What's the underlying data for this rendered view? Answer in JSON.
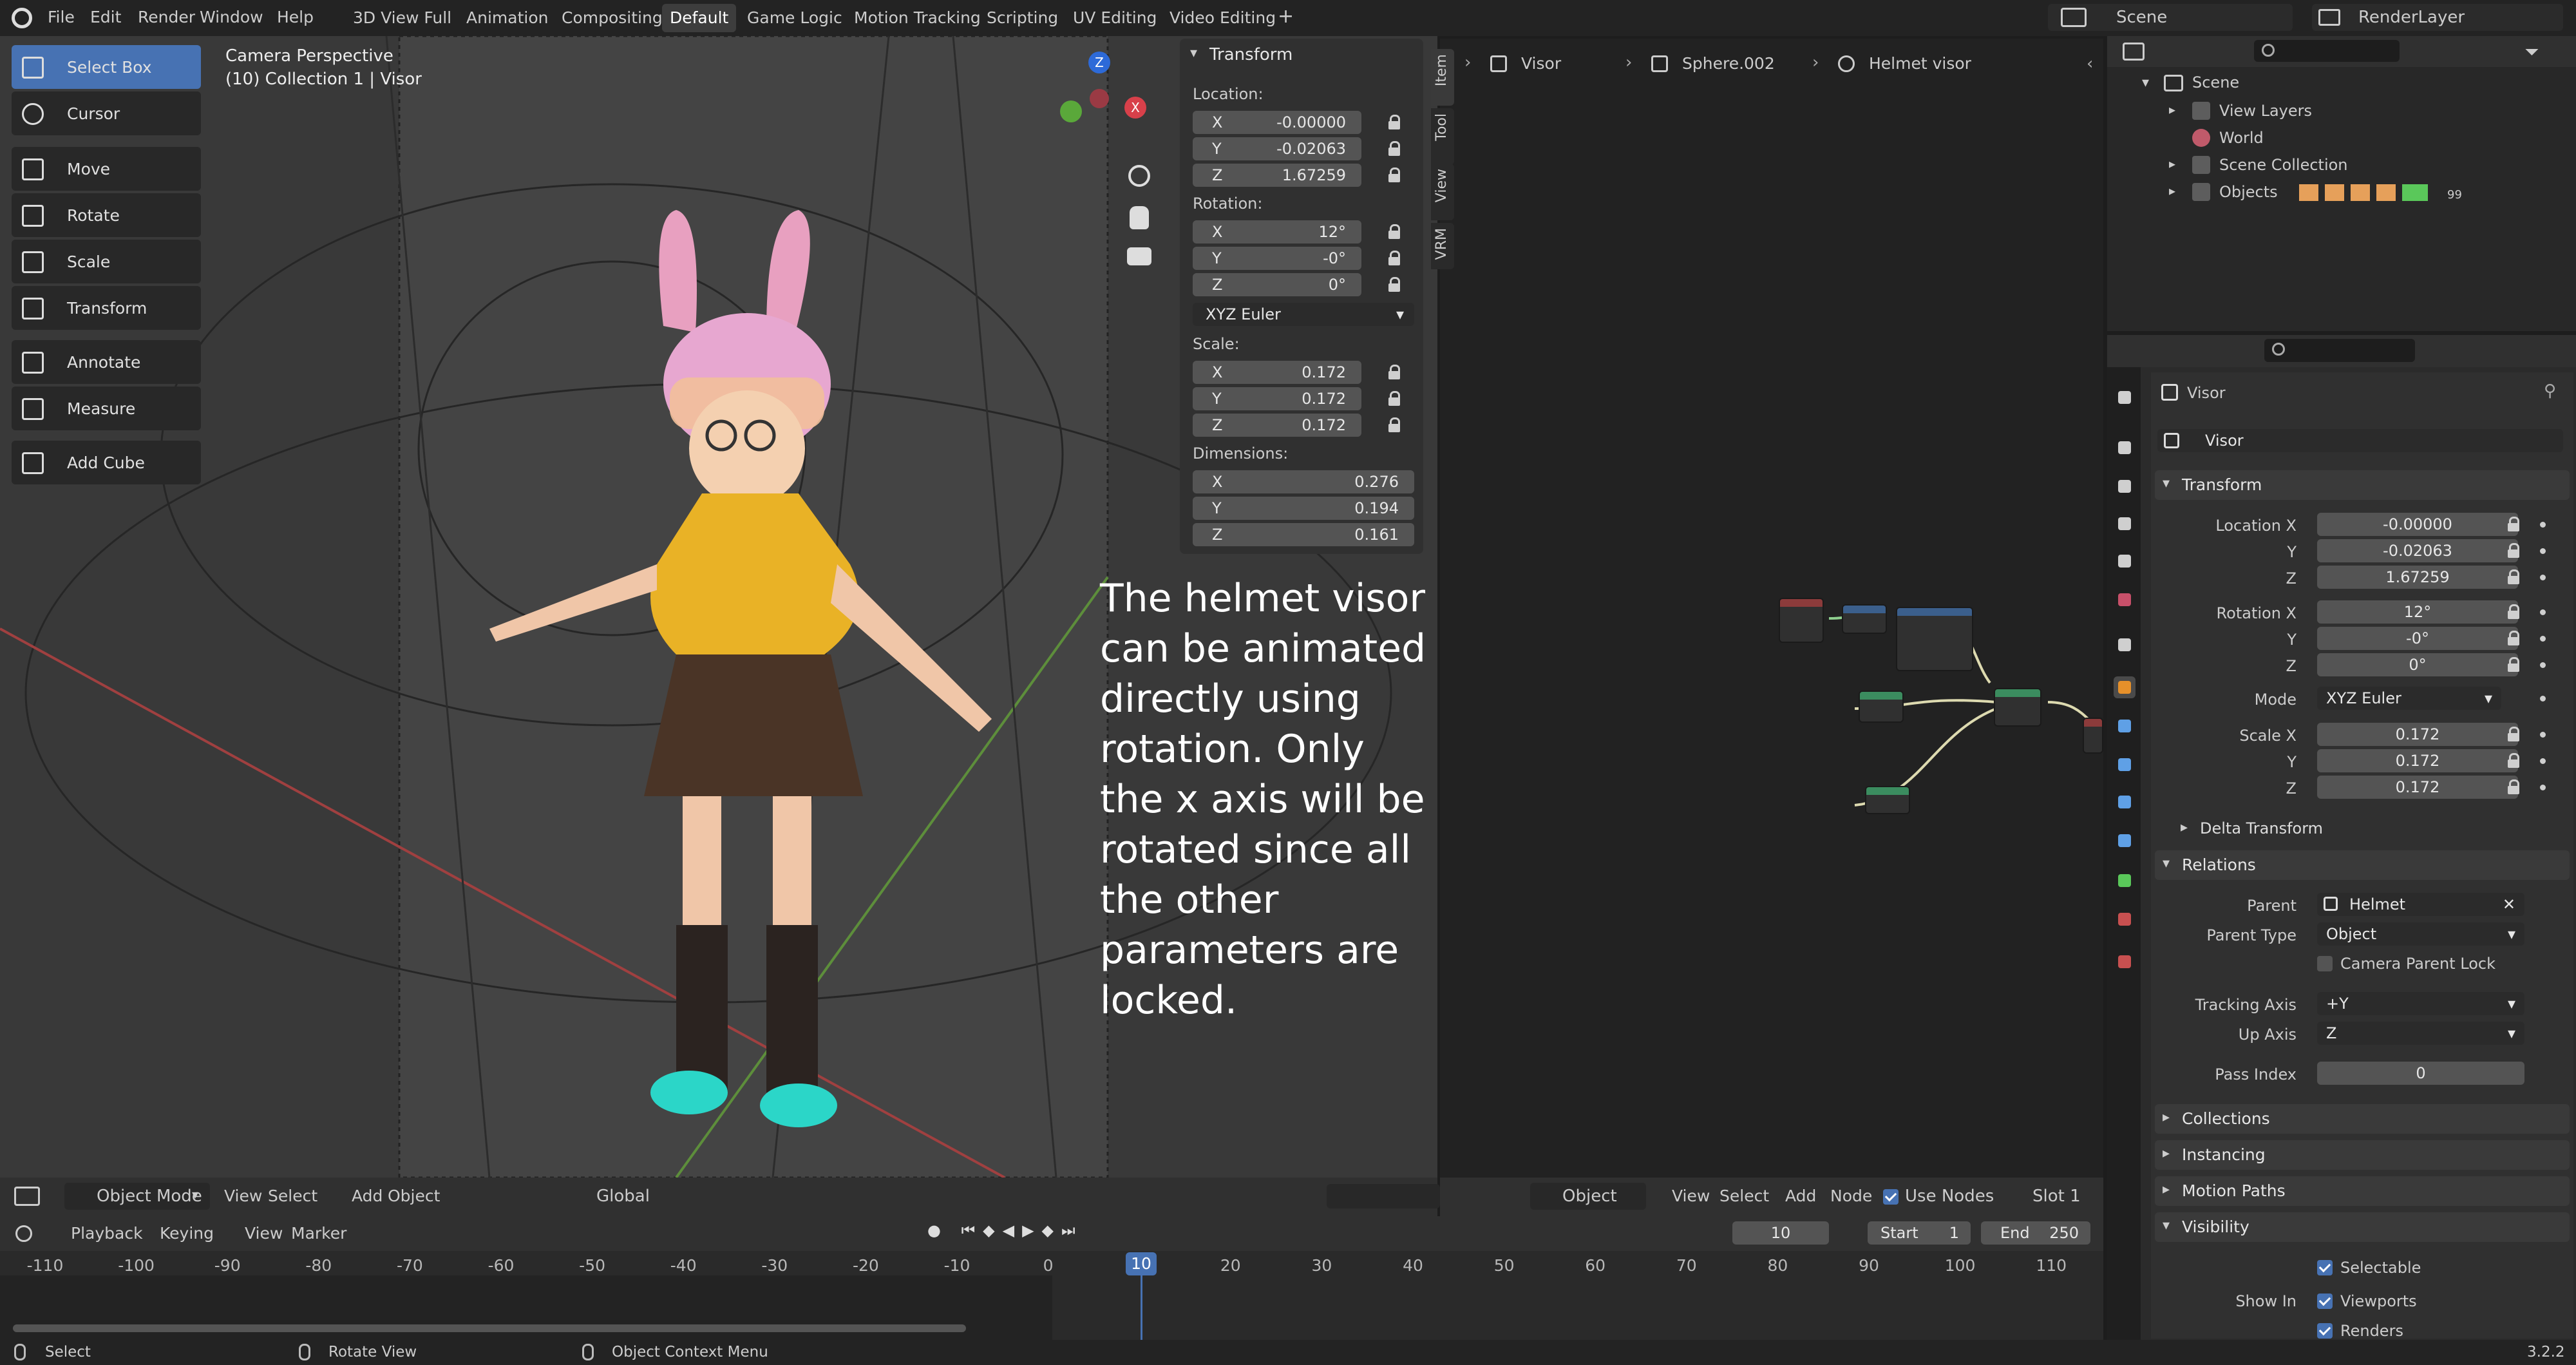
{
  "menu": [
    "File",
    "Edit",
    "Render",
    "Window",
    "Help"
  ],
  "workspaces": [
    "3D View Full",
    "Animation",
    "Compositing",
    "Default",
    "Game Logic",
    "Motion Tracking",
    "Scripting",
    "UV Editing",
    "Video Editing"
  ],
  "active_workspace": "Default",
  "add_tab": "+",
  "scene_name": "Scene",
  "renderlayer_name": "RenderLayer",
  "tools": [
    "Select Box",
    "Cursor",
    "Move",
    "Rotate",
    "Scale",
    "Transform",
    "Annotate",
    "Measure",
    "Add Cube"
  ],
  "viewport": {
    "title": "Camera Perspective",
    "subtitle": "(10) Collection 1 | Visor",
    "caption": "The helmet visor can be animated directly using rotation. Only the x axis will be rotated since all the other parameters are locked."
  },
  "npanel": {
    "header": "Transform",
    "location_label": "Location:",
    "loc": [
      "-0.00000",
      "-0.02063",
      "1.67259"
    ],
    "rotation_label": "Rotation:",
    "rot": [
      "12°",
      "-0°",
      "0°"
    ],
    "rot_mode": "XYZ Euler",
    "scale_label": "Scale:",
    "scale": [
      "0.172",
      "0.172",
      "0.172"
    ],
    "dimensions_label": "Dimensions:",
    "dim": [
      "0.276",
      "0.194",
      "0.161"
    ],
    "axis": [
      "X",
      "Y",
      "Z"
    ],
    "tabs": [
      "Item",
      "Tool",
      "View",
      "VRM"
    ]
  },
  "breadcrumb": [
    "Visor",
    "Sphere.002",
    "Helmet visor"
  ],
  "outliner": {
    "scene": "Scene",
    "items": [
      "View Layers",
      "World",
      "Scene Collection",
      "Objects"
    ],
    "objects_count": "99"
  },
  "props": {
    "object_name": "Visor",
    "data_name": "Visor",
    "transform": "Transform",
    "location_label": "Location X",
    "loc": [
      "-0.00000",
      "-0.02063",
      "1.67259"
    ],
    "rotation_label": "Rotation X",
    "rot": [
      "12°",
      "-0°",
      "0°"
    ],
    "y_label": "Y",
    "z_label": "Z",
    "mode_label": "Mode",
    "mode": "XYZ Euler",
    "scale_label": "Scale X",
    "scale": [
      "0.172",
      "0.172",
      "0.172"
    ],
    "delta": "Delta Transform",
    "relations": "Relations",
    "parent_label": "Parent",
    "parent": "Helmet",
    "parent_type_label": "Parent Type",
    "parent_type": "Object",
    "camera_lock": "Camera Parent Lock",
    "tracking_label": "Tracking Axis",
    "tracking": "+Y",
    "up_label": "Up Axis",
    "up": "Z",
    "pass_label": "Pass Index",
    "pass": "0",
    "collections": "Collections",
    "instancing": "Instancing",
    "motion_paths": "Motion Paths",
    "visibility": "Visibility",
    "selectable": "Selectable",
    "show_in": "Show In",
    "viewports": "Viewports",
    "renders": "Renders"
  },
  "viewport_header": {
    "mode": "Object Mode",
    "menus": [
      "View",
      "Select",
      "Add",
      "Object"
    ],
    "orientation": "Global"
  },
  "node_header": {
    "type": "Object",
    "menus": [
      "View",
      "Select",
      "Add",
      "Node"
    ],
    "use_nodes": "Use Nodes",
    "slot": "Slot 1"
  },
  "timeline": {
    "menus": [
      "Playback",
      "Keying",
      "View",
      "Marker"
    ],
    "frame": "10",
    "start_label": "Start",
    "start": "1",
    "end_label": "End",
    "end": "250",
    "ticks": [
      "-110",
      "-100",
      "-90",
      "-80",
      "-70",
      "-60",
      "-50",
      "-40",
      "-30",
      "-20",
      "-10",
      "0",
      "10",
      "20",
      "30",
      "40",
      "50",
      "60",
      "70",
      "80",
      "90",
      "100",
      "110"
    ]
  },
  "status": {
    "select": "Select",
    "rotate": "Rotate View",
    "context": "Object Context Menu",
    "version": "3.2.2"
  }
}
